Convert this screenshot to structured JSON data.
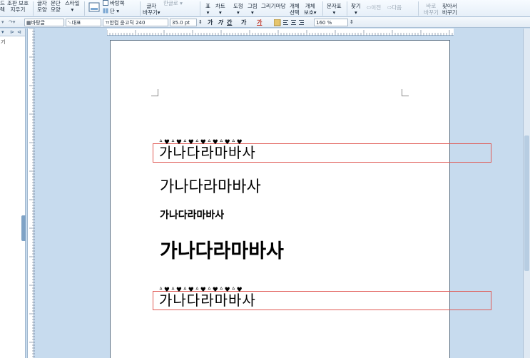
{
  "ribbon": {
    "items": [
      {
        "id": "r1",
        "l1": "드",
        "l2": "렉"
      },
      {
        "id": "r2",
        "l1": "조판 보호",
        "l2": "지우기"
      },
      {
        "id": "r3",
        "l1": "글자",
        "l2": "모양"
      },
      {
        "id": "r4",
        "l1": "문단",
        "l2": "모양"
      },
      {
        "id": "r5",
        "l1": "스타일",
        "l2": "▾"
      },
      {
        "id": "r6",
        "l1": "바탕쪽",
        "l2": ""
      },
      {
        "id": "r7",
        "l1": "단 ▾",
        "l2": ""
      },
      {
        "id": "r8",
        "l1": "글자",
        "l2": "바꾸기▾"
      },
      {
        "id": "r9",
        "l1": "한글로 ▾",
        "l2": ""
      },
      {
        "id": "r10",
        "l1": "표",
        "l2": "▾"
      },
      {
        "id": "r11",
        "l1": "차트",
        "l2": "▾"
      },
      {
        "id": "r12",
        "l1": "도형",
        "l2": "▾"
      },
      {
        "id": "r13",
        "l1": "그림",
        "l2": "▾"
      },
      {
        "id": "r14",
        "l1": "그리기마당",
        "l2": ""
      },
      {
        "id": "r15",
        "l1": "개체",
        "l2": "선택"
      },
      {
        "id": "r16",
        "l1": "개체",
        "l2": "보호▾"
      },
      {
        "id": "r17",
        "l1": "문자표",
        "l2": "▾"
      },
      {
        "id": "r18",
        "l1": "찾기",
        "l2": "▾"
      },
      {
        "id": "r19",
        "l1": "이전",
        "l2": ""
      },
      {
        "id": "r20",
        "l1": "다음",
        "l2": ""
      },
      {
        "id": "r21",
        "l1": "바로",
        "l2": "바꾸기"
      },
      {
        "id": "r22",
        "l1": "찾아서",
        "l2": "바꾸기"
      }
    ]
  },
  "format": {
    "style_name": "바탕글",
    "lang": "대표",
    "font": "한컴 윤고딕 240",
    "size": "35.0",
    "size_unit": "pt",
    "bold": "가",
    "italic": "가",
    "underline": "간",
    "strike": "가",
    "color": "가",
    "zoom": "160",
    "zoom_unit": "%"
  },
  "left_panel": {
    "icons": [
      "▾",
      "⊳",
      "⊲"
    ],
    "item": "기"
  },
  "document": {
    "lines": [
      "가나다라마바사",
      "가나다라마바사",
      "가나다라마바사",
      "가나다라마바사",
      "가나다라마바사"
    ],
    "decorations": "ᐞ♥ᐞ♥ᐞ♥ᐞ♥ᐞ♥ᐞ♥ᐞ♥"
  }
}
